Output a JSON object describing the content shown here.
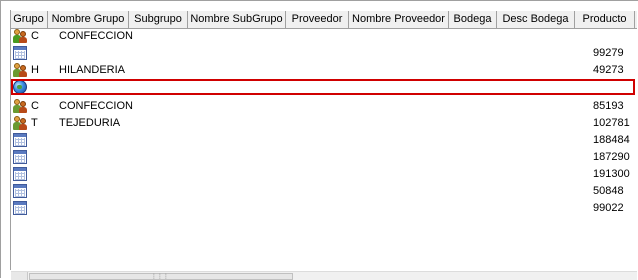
{
  "columns": [
    {
      "label": "Grupo"
    },
    {
      "label": "Nombre Grupo"
    },
    {
      "label": "Subgrupo"
    },
    {
      "label": "Nombre SubGrupo"
    },
    {
      "label": "Proveedor"
    },
    {
      "label": "Nombre Proveedor"
    },
    {
      "label": "Bodega"
    },
    {
      "label": "Desc Bodega"
    },
    {
      "label": "Producto"
    }
  ],
  "rows": [
    {
      "icon": "people-icon",
      "grupo": "C",
      "nombre_grupo": "CONFECCION",
      "producto": ""
    },
    {
      "icon": "calendar-icon",
      "grupo": "",
      "nombre_grupo": "",
      "producto": "99279"
    },
    {
      "icon": "people-icon",
      "grupo": "H",
      "nombre_grupo": "HILANDERIA",
      "producto": "49273"
    },
    {
      "icon": "globe-icon",
      "grupo": "",
      "nombre_grupo": "",
      "producto": "",
      "selected": true
    },
    {
      "icon": "people-icon",
      "grupo": "C",
      "nombre_grupo": "CONFECCION",
      "producto": "85193"
    },
    {
      "icon": "people-icon",
      "grupo": "T",
      "nombre_grupo": "TEJEDURIA",
      "producto": "102781"
    },
    {
      "icon": "calendar-icon",
      "grupo": "",
      "nombre_grupo": "",
      "producto": "188484"
    },
    {
      "icon": "calendar-icon",
      "grupo": "",
      "nombre_grupo": "",
      "producto": "187290"
    },
    {
      "icon": "calendar-icon",
      "grupo": "",
      "nombre_grupo": "",
      "producto": "191300"
    },
    {
      "icon": "calendar-icon",
      "grupo": "",
      "nombre_grupo": "",
      "producto": "50848"
    },
    {
      "icon": "calendar-icon",
      "grupo": "",
      "nombre_grupo": "",
      "producto": "99022"
    }
  ],
  "colors": {
    "selection_border": "#d00000",
    "header_bg": "#f0f0f0",
    "grid_line": "#a0a0a0"
  }
}
